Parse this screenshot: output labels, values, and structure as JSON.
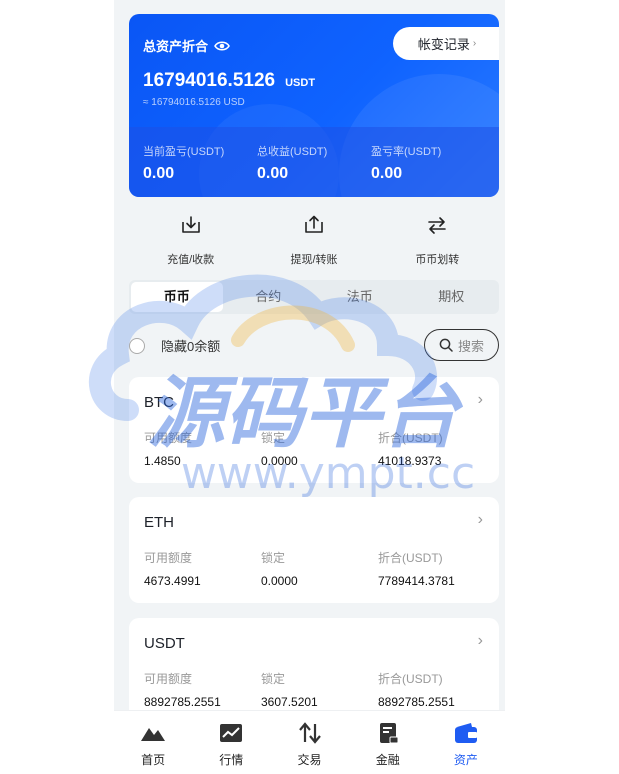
{
  "header": {
    "title": "总资产折合",
    "history_label": "帐变记录",
    "history_arrow": "›",
    "total_value": "16794016.5126",
    "total_unit": "USDT",
    "total_usd": "≈ 16794016.5126 USD",
    "stats": [
      {
        "label": "当前盈亏(USDT)",
        "value": "0.00"
      },
      {
        "label": "总收益(USDT)",
        "value": "0.00"
      },
      {
        "label": "盈亏率(USDT)",
        "value": "0.00"
      }
    ]
  },
  "actions": [
    {
      "label": "充值/收款",
      "icon": "download-icon"
    },
    {
      "label": "提现/转账",
      "icon": "upload-icon"
    },
    {
      "label": "币币划转",
      "icon": "transfer-icon"
    }
  ],
  "tabs": [
    "币币",
    "合约",
    "法币",
    "期权"
  ],
  "active_tab": "币币",
  "filter": {
    "hide_zero_label": "隐藏0余额",
    "search_placeholder": "搜索"
  },
  "assets": [
    {
      "name": "BTC",
      "available_label": "可用额度",
      "available": "1.4850",
      "locked_label": "锁定",
      "locked": "0.0000",
      "value_label": "折合(USDT)",
      "value": "41018.9373"
    },
    {
      "name": "ETH",
      "available_label": "可用额度",
      "available": "4673.4991",
      "locked_label": "锁定",
      "locked": "0.0000",
      "value_label": "折合(USDT)",
      "value": "7789414.3781"
    },
    {
      "name": "USDT",
      "available_label": "可用额度",
      "available": "8892785.2551",
      "locked_label": "锁定",
      "locked": "3607.5201",
      "value_label": "折合(USDT)",
      "value": "8892785.2551"
    }
  ],
  "watermark": {
    "text_cn": "源码平台",
    "text_en": "www.ympt.cc"
  },
  "nav": [
    {
      "label": "首页",
      "icon": "home-icon"
    },
    {
      "label": "行情",
      "icon": "chart-icon"
    },
    {
      "label": "交易",
      "icon": "trade-icon"
    },
    {
      "label": "金融",
      "icon": "finance-icon"
    },
    {
      "label": "资产",
      "icon": "wallet-icon"
    }
  ],
  "colors": {
    "primary": "#1f5cf2",
    "card_gradient_start": "#0a56f5",
    "background": "#f1f4f6"
  }
}
